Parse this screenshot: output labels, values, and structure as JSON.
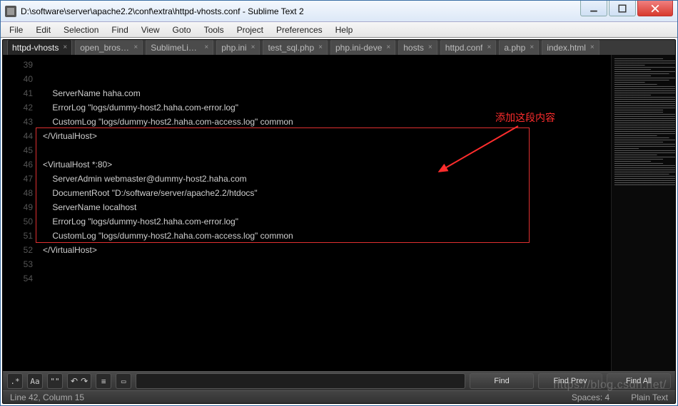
{
  "window": {
    "title": "D:\\software\\server\\apache2.2\\conf\\extra\\httpd-vhosts.conf - Sublime Text 2"
  },
  "menu": [
    "File",
    "Edit",
    "Selection",
    "Find",
    "View",
    "Goto",
    "Tools",
    "Project",
    "Preferences",
    "Help"
  ],
  "tabs": [
    {
      "label": "httpd-vhosts",
      "active": true
    },
    {
      "label": "open_broswe",
      "active": false
    },
    {
      "label": "SublimeLinte",
      "active": false
    },
    {
      "label": "php.ini",
      "active": false
    },
    {
      "label": "test_sql.php",
      "active": false
    },
    {
      "label": "php.ini-deve",
      "active": false
    },
    {
      "label": "hosts",
      "active": false
    },
    {
      "label": "httpd.conf",
      "active": false
    },
    {
      "label": "a.php",
      "active": false
    },
    {
      "label": "index.html",
      "active": false
    }
  ],
  "gutter_start": 39,
  "gutter_end": 54,
  "code_lines": [
    "    ServerName haha.com",
    "    ErrorLog \"logs/dummy-host2.haha.com-error.log\"",
    "    CustomLog \"logs/dummy-host2.haha.com-access.log\" common",
    "</VirtualHost>",
    "",
    "<VirtualHost *:80>",
    "    ServerAdmin webmaster@dummy-host2.haha.com",
    "    DocumentRoot \"D:/software/server/apache2.2/htdocs\"",
    "    ServerName localhost",
    "    ErrorLog \"logs/dummy-host2.haha.com-error.log\"",
    "    CustomLog \"logs/dummy-host2.haha.com-access.log\" common",
    "</VirtualHost>",
    "",
    "",
    "",
    ""
  ],
  "annotation_text": "添加这段内容",
  "findbar": {
    "icons": [
      ".*",
      "Aa",
      "\"\"",
      "↶",
      "↷",
      "≡",
      "▭"
    ],
    "find_label": "Find",
    "findprev_label": "Find Prev",
    "findall_label": "Find All",
    "input_value": ""
  },
  "status": {
    "left": "Line 42, Column 15",
    "spaces": "Spaces: 4",
    "syntax": "Plain Text"
  },
  "watermark": "https://blog.csdn.net/"
}
